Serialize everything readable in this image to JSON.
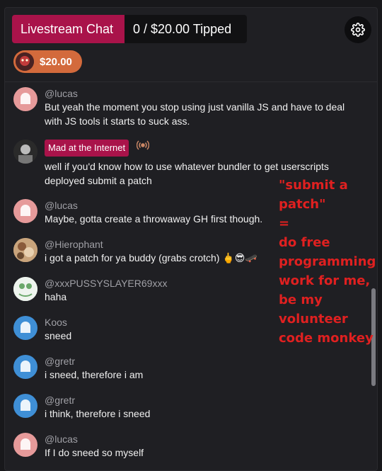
{
  "header": {
    "title": "Livestream Chat",
    "tipped_status": "0 / $20.00 Tipped"
  },
  "tip": {
    "amount": "$20.00",
    "accent_color": "#d36a3c"
  },
  "messages": [
    {
      "user": "@lucas",
      "text": "But yeah the moment you stop using just vanilla JS and have to deal with JS tools it starts to suck ass.",
      "avatar": "red"
    },
    {
      "user": "Mad at the Internet",
      "text": "well if you'd know how to use whatever bundler to get userscripts deployed submit a patch",
      "avatar": "dark",
      "badge": true
    },
    {
      "user": "@lucas",
      "text": "Maybe, gotta create a throwaway GH first though.",
      "avatar": "red"
    },
    {
      "user": "@Hierophant",
      "text": "i got a patch for ya buddy (grabs crotch) 🖕😎🛹",
      "avatar": "brown"
    },
    {
      "user": "@xxxPUSSYSLAYER69xxx",
      "text": "haha",
      "avatar": "green"
    },
    {
      "user": "Koos",
      "text": "sneed",
      "avatar": "blue"
    },
    {
      "user": "@gretr",
      "text": "i sneed, therefore i am",
      "avatar": "blue"
    },
    {
      "user": "@gretr",
      "text": "i think, therefore i sneed",
      "avatar": "blue"
    },
    {
      "user": "@lucas",
      "text": "If I do sneed so myself",
      "avatar": "red"
    }
  ],
  "annotation": {
    "text": "\"submit a patch\"\n=\ndo free programming work for me, be my volunteer code monkey"
  },
  "colors": {
    "brand": "#a9134a",
    "annotation": "#e02020"
  }
}
